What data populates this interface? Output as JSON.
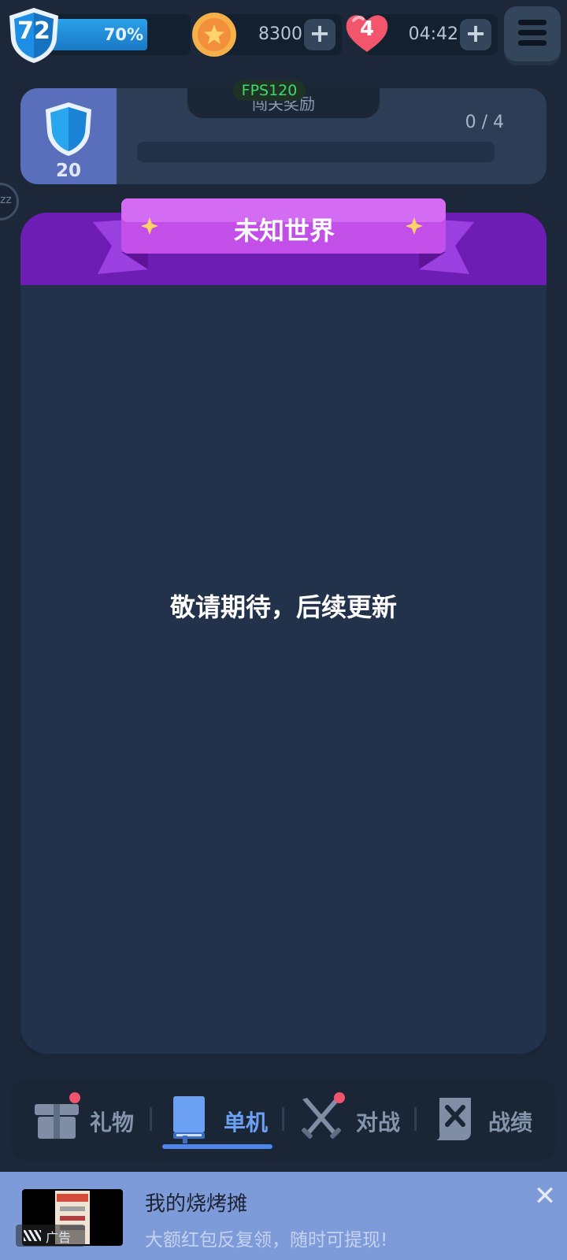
{
  "top_bar": {
    "level": "72",
    "level_progress_pct": 70,
    "level_progress_label": "70%",
    "coins": "8300",
    "lives": "4",
    "life_timer": "04:42",
    "plus_symbol": "+",
    "icons": {
      "level": "shield-icon",
      "coins": "star-coin-icon",
      "lives": "heart-icon",
      "menu": "hamburger-menu-icon"
    }
  },
  "reward_card": {
    "title": "闯关奖励",
    "fps_badge": "FPS120",
    "shield_count": "20",
    "progress_text": "0 / 4",
    "progress_fraction": 0
  },
  "side_button": {
    "label": "zz"
  },
  "panel": {
    "title": "未知世界",
    "empty_message": "敬请期待，后续更新"
  },
  "bottom_nav": {
    "items": [
      {
        "label": "礼物",
        "icon": "gift-icon",
        "active": false,
        "badge": true
      },
      {
        "label": "单机",
        "icon": "book-icon",
        "active": true,
        "badge": false
      },
      {
        "label": "对战",
        "icon": "crossed-swords-icon",
        "active": false,
        "badge": true
      },
      {
        "label": "战绩",
        "icon": "record-scroll-icon",
        "active": false,
        "badge": false
      }
    ]
  },
  "ad_banner": {
    "title": "我的烧烤摊",
    "subtitle": "大额红包反复领，随时可提现!",
    "badge": "广告",
    "close_symbol": "✕"
  },
  "colors": {
    "background": "#1c2739",
    "panel": "#23324b",
    "header_purple": "#6d1db4",
    "ribbon_pink": "#c24fe8",
    "nav_active": "#6ca0f3",
    "badge_red": "#f0546e",
    "ad_bg": "#7e9bd9"
  }
}
